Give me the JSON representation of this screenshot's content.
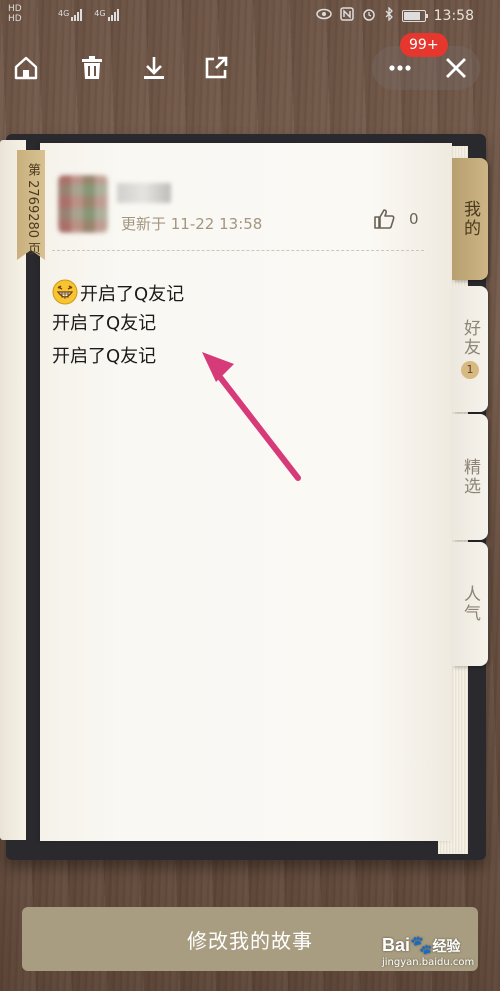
{
  "status_bar": {
    "hd_top": "HD",
    "hd_bottom": "HD",
    "net1": "4G",
    "net2": "4G",
    "time": "13:58"
  },
  "toolbar": {
    "badge_count": "99+"
  },
  "note": {
    "page_ribbon": "第 2769280 页",
    "updated": "更新于 11-22 13:58",
    "like_count": "0",
    "lines": [
      "开启了Q友记",
      "开启了Q友记",
      "开启了Q友记"
    ]
  },
  "tabs": {
    "mine": "我的",
    "friends": "好友",
    "friends_badge": "1",
    "featured": "精选",
    "popular": "人气"
  },
  "bottom_button": "修改我的故事",
  "watermark": {
    "logo_a": "Bai",
    "logo_b": "经验",
    "url": "jingyan.baidu.com"
  },
  "colors": {
    "accent_gold": "#c9b07e",
    "button": "#a89d80",
    "badge_red": "#e5372e",
    "arrow_pink": "#d63a78"
  }
}
